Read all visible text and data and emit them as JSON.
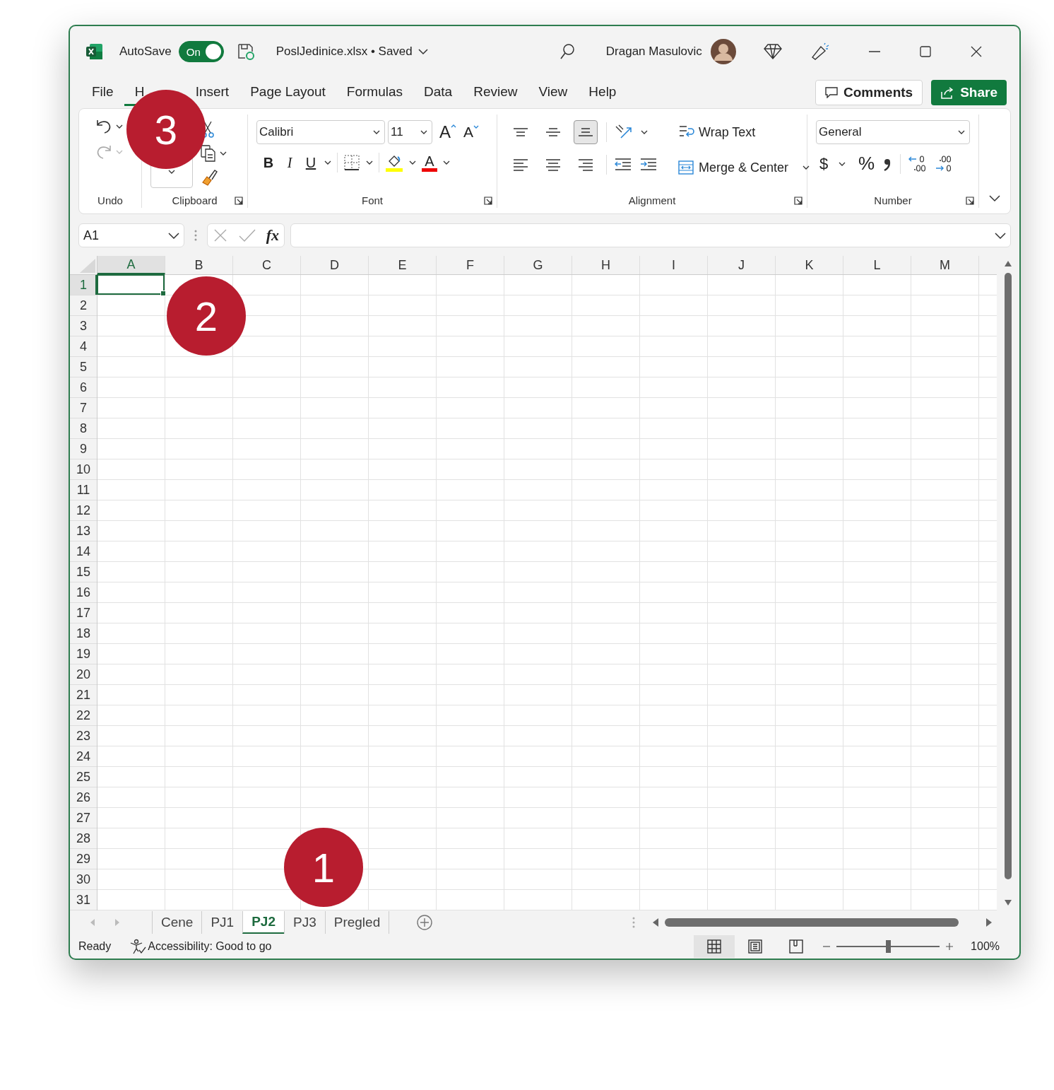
{
  "title_bar": {
    "autosave": {
      "label": "AutoSave",
      "on": true,
      "state_label": "On"
    },
    "file_title": "PoslJedinice.xlsx • Saved",
    "user_name": "Dragan Masulovic"
  },
  "menu_tabs": [
    {
      "label": "File",
      "selected": false
    },
    {
      "label": "H",
      "selected": true
    },
    {
      "label": "Insert",
      "selected": false
    },
    {
      "label": "Page Layout",
      "selected": false
    },
    {
      "label": "Formulas",
      "selected": false
    },
    {
      "label": "Data",
      "selected": false
    },
    {
      "label": "Review",
      "selected": false
    },
    {
      "label": "View",
      "selected": false
    },
    {
      "label": "Help",
      "selected": false
    }
  ],
  "actions": {
    "comments": "Comments",
    "share": "Share"
  },
  "ribbon": {
    "undo": {
      "label": "Undo"
    },
    "clipboard": {
      "label": "Clipboard"
    },
    "font": {
      "label": "Font",
      "font_name": "Calibri",
      "font_size": "11",
      "grow": "A",
      "shrink": "A",
      "styles": [
        {
          "kind": "bold",
          "label": "B"
        },
        {
          "kind": "italic",
          "label": "I"
        },
        {
          "kind": "underline",
          "label": "U"
        }
      ],
      "font_color": "A"
    },
    "alignment": {
      "label": "Alignment",
      "row1": [
        {
          "kind": "top",
          "selected": false
        },
        {
          "kind": "middle",
          "selected": false
        },
        {
          "kind": "bottom",
          "selected": true
        }
      ],
      "row2": [
        {
          "kind": "left",
          "selected": false
        },
        {
          "kind": "center",
          "selected": false
        },
        {
          "kind": "right",
          "selected": false
        }
      ],
      "wrap_text": "Wrap Text",
      "merge": "Merge & Center"
    },
    "number": {
      "label": "Number",
      "format": "General",
      "currency": "$",
      "percent": "%"
    }
  },
  "formula_bar": {
    "name_box": "A1",
    "fx": "fx"
  },
  "grid": {
    "columns": [
      {
        "label": "A",
        "selected": true
      },
      {
        "label": "B",
        "selected": false
      },
      {
        "label": "C",
        "selected": false
      },
      {
        "label": "D",
        "selected": false
      },
      {
        "label": "E",
        "selected": false
      },
      {
        "label": "F",
        "selected": false
      },
      {
        "label": "G",
        "selected": false
      },
      {
        "label": "H",
        "selected": false
      },
      {
        "label": "I",
        "selected": false
      },
      {
        "label": "J",
        "selected": false
      },
      {
        "label": "K",
        "selected": false
      },
      {
        "label": "L",
        "selected": false
      },
      {
        "label": "M",
        "selected": false
      }
    ],
    "rows": [
      {
        "label": "1",
        "selected": true
      },
      {
        "label": "2",
        "selected": false
      },
      {
        "label": "3",
        "selected": false
      },
      {
        "label": "4",
        "selected": false
      },
      {
        "label": "5",
        "selected": false
      },
      {
        "label": "6",
        "selected": false
      },
      {
        "label": "7",
        "selected": false
      },
      {
        "label": "8",
        "selected": false
      },
      {
        "label": "9",
        "selected": false
      },
      {
        "label": "10",
        "selected": false
      },
      {
        "label": "11",
        "selected": false
      },
      {
        "label": "12",
        "selected": false
      },
      {
        "label": "13",
        "selected": false
      },
      {
        "label": "14",
        "selected": false
      },
      {
        "label": "15",
        "selected": false
      },
      {
        "label": "16",
        "selected": false
      },
      {
        "label": "17",
        "selected": false
      },
      {
        "label": "18",
        "selected": false
      },
      {
        "label": "19",
        "selected": false
      },
      {
        "label": "20",
        "selected": false
      },
      {
        "label": "21",
        "selected": false
      },
      {
        "label": "22",
        "selected": false
      },
      {
        "label": "23",
        "selected": false
      },
      {
        "label": "24",
        "selected": false
      },
      {
        "label": "25",
        "selected": false
      },
      {
        "label": "26",
        "selected": false
      },
      {
        "label": "27",
        "selected": false
      },
      {
        "label": "28",
        "selected": false
      },
      {
        "label": "29",
        "selected": false
      },
      {
        "label": "30",
        "selected": false
      },
      {
        "label": "31",
        "selected": false
      }
    ]
  },
  "sheet_tabs": [
    {
      "label": "Cene",
      "selected": false
    },
    {
      "label": "PJ1",
      "selected": false
    },
    {
      "label": "PJ2",
      "selected": true
    },
    {
      "label": "PJ3",
      "selected": false
    },
    {
      "label": "Pregled",
      "selected": false
    }
  ],
  "status_bar": {
    "status": "Ready",
    "accessibility": "Accessibility: Good to go",
    "views": [
      {
        "kind": "normal",
        "selected": true
      },
      {
        "kind": "page_layout",
        "selected": false
      },
      {
        "kind": "page_break",
        "selected": false
      }
    ],
    "zoom": {
      "level": 0.5,
      "reading": "100%"
    }
  },
  "callouts": [
    {
      "number": "3"
    },
    {
      "number": "2"
    },
    {
      "number": "1"
    }
  ]
}
